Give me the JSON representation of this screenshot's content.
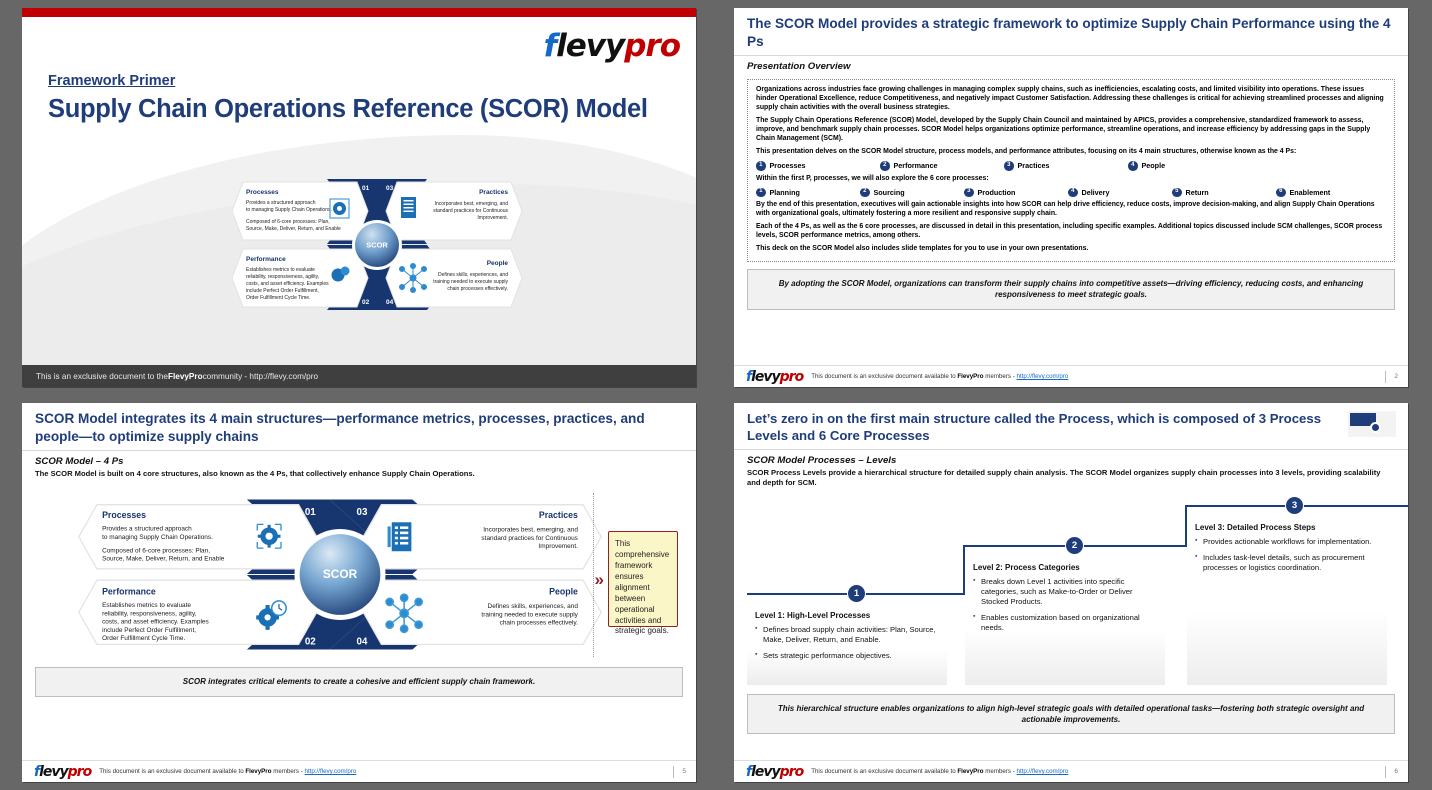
{
  "slide1": {
    "logo": {
      "part1": "f",
      "part2": "levy",
      "part3": "pro"
    },
    "kicker": "Framework Primer",
    "title": "Supply Chain Operations Reference (SCOR) Model",
    "footer_pre": "This is an exclusive document to the ",
    "footer_bold": "FlevyPro",
    "footer_post": " community - http://flevy.com/pro",
    "center_label": "SCOR",
    "quadrants": [
      {
        "num": "01",
        "heading": "Processes",
        "icon": "gear-in-frame-icon",
        "align": "left",
        "body": [
          "Provides a structured approach to managing Supply Chain Operations.",
          "Composed of 6-core processes: Plan, Source, Make, Deliver, Return, and Enable"
        ]
      },
      {
        "num": "02",
        "heading": "Performance",
        "icon": "gear-clock-icon",
        "align": "left",
        "body": [
          "Establishes metrics to evaluate reliability, responsiveness, agility, costs, and asset efficiency. Examples include Perfect Order Fulfillment, Order Fulfillment Cycle Time."
        ]
      },
      {
        "num": "03",
        "heading": "Practices",
        "icon": "checklist-icon",
        "align": "right",
        "body": [
          "Incorporates best, emerging, and standard practices for Continuous Improvement."
        ]
      },
      {
        "num": "04",
        "heading": "People",
        "icon": "network-nodes-icon",
        "align": "right",
        "body": [
          "Defines skills, experiences, and training needed to execute supply chain processes effectively."
        ]
      }
    ]
  },
  "slide2": {
    "title": "The SCOR Model provides a strategic framework to optimize Supply Chain Performance using the 4 Ps",
    "subhead": "Presentation Overview",
    "paragraphs": [
      "Organizations across industries face growing challenges in managing complex supply chains, such as inefficiencies, escalating costs, and limited visibility into operations. These issues hinder Operational Excellence, reduce Competitiveness, and negatively impact Customer Satisfaction. Addressing these challenges is critical for achieving streamlined processes and aligning supply chain activities with the overall business strategies.",
      "The Supply Chain Operations Reference (SCOR) Model, developed by the Supply Chain Council and maintained by APICS, provides a comprehensive, standardized framework to assess, improve, and benchmark supply chain processes. SCOR Model helps organizations optimize performance, streamline operations, and increase efficiency by addressing gaps in the Supply Chain Management (SCM).",
      "This presentation delves on the SCOR Model structure, process models, and performance attributes, focusing on its 4 main structures, otherwise known as the 4 Ps:"
    ],
    "four_ps": [
      {
        "num": "1",
        "label": "Processes"
      },
      {
        "num": "2",
        "label": "Performance"
      },
      {
        "num": "3",
        "label": "Practices"
      },
      {
        "num": "4",
        "label": "People"
      }
    ],
    "mid_text": "Within the first P, processes, we will also explore the 6 core processes:",
    "six_processes": [
      {
        "num": "1",
        "label": "Planning"
      },
      {
        "num": "2",
        "label": "Sourcing"
      },
      {
        "num": "3",
        "label": "Production"
      },
      {
        "num": "4",
        "label": "Delivery"
      },
      {
        "num": "5",
        "label": "Return"
      },
      {
        "num": "6",
        "label": "Enablement"
      }
    ],
    "paragraphs2": [
      "By the end of this presentation, executives will gain actionable insights into how SCOR can help drive efficiency, reduce costs, improve decision-making, and align Supply Chain Operations with organizational goals, ultimately fostering a more resilient and responsive supply chain.",
      "Each of the 4 Ps, as well as the 6 core processes, are discussed in detail in this presentation, including specific examples. Additional topics discussed include SCM challenges, SCOR process levels, SCOR performance metrics, among others.",
      "This deck on the SCOR Model also includes slide templates for you to use in your own presentations."
    ],
    "takeaway": "By adopting the SCOR Model, organizations can transform their supply chains into competitive assets—driving efficiency, reducing costs, and enhancing responsiveness to meet strategic goals.",
    "page": "2"
  },
  "slide5": {
    "title": "SCOR Model integrates its 4 main structures—performance metrics, processes, practices, and people—to optimize supply chains",
    "subhead": "SCOR Model – 4 Ps",
    "leadin": "The SCOR Model is built on 4 core structures, also known as the 4 Ps, that collectively enhance Supply Chain Operations.",
    "center_label": "SCOR",
    "quadrants": [
      {
        "num": "01",
        "heading": "Processes",
        "icon": "gear-in-frame-icon",
        "align": "left",
        "body": [
          "Provides a structured approach to managing Supply Chain Operations.",
          "Composed of 6-core processes: Plan, Source, Make, Deliver, Return, and Enable"
        ]
      },
      {
        "num": "02",
        "heading": "Performance",
        "icon": "gear-clock-icon",
        "align": "left",
        "body": [
          "Establishes metrics to evaluate reliability, responsiveness, agility, costs, and asset efficiency. Examples include Perfect Order Fulfillment, Order Fulfillment Cycle Time."
        ]
      },
      {
        "num": "03",
        "heading": "Practices",
        "icon": "checklist-icon",
        "align": "right",
        "body": [
          "Incorporates best, emerging, and standard practices for Continuous Improvement."
        ]
      },
      {
        "num": "04",
        "heading": "People",
        "icon": "network-nodes-icon",
        "align": "right",
        "body": [
          "Defines skills, experiences, and training needed to execute supply chain processes effectively."
        ]
      }
    ],
    "callout": "This comprehensive framework ensures alignment between operational activities and strategic goals.",
    "takeaway": "SCOR integrates critical elements to create a cohesive and efficient supply chain framework.",
    "page": "5"
  },
  "slide6": {
    "title": "Let’s zero in on the first main structure called the Process, which is composed of 3 Process Levels and 6 Core Processes",
    "subhead": "SCOR Model Processes – Levels",
    "leadin": "SCOR Process Levels provide a hierarchical structure for detailed supply chain analysis. The SCOR Model organizes supply chain processes into 3 levels, providing scalability and depth for SCM.",
    "levels": [
      {
        "badge": "1",
        "title": "Level 1: High-Level Processes",
        "bullets": [
          "Defines broad supply chain activities: Plan, Source, Make, Deliver, Return, and Enable.",
          "Sets strategic performance objectives."
        ]
      },
      {
        "badge": "2",
        "title": "Level 2: Process Categories",
        "bullets": [
          "Breaks down Level 1 activities into specific categories, such as Make-to-Order or Deliver Stocked Products.",
          "Enables customization based on organizational needs."
        ]
      },
      {
        "badge": "3",
        "title": "Level 3: Detailed Process Steps",
        "bullets": [
          "Provides actionable workflows for implementation.",
          "Includes task-level details, such as procurement processes or logistics coordination."
        ]
      }
    ],
    "takeaway": "This hierarchical structure enables organizations to align high-level strategic goals with detailed operational tasks—fostering both strategic oversight and actionable improvements.",
    "page": "6"
  },
  "common_footer": {
    "pre": "This document is an exclusive document available to ",
    "bold": "FlevyPro",
    "mid": " members - ",
    "link": "http://flevy.com/pro"
  },
  "colors": {
    "navy": "#1f3d7a",
    "red": "#c00000",
    "blue": "#1569c7",
    "callout_bg": "#fbf6c8",
    "callout_border": "#8f2222"
  }
}
